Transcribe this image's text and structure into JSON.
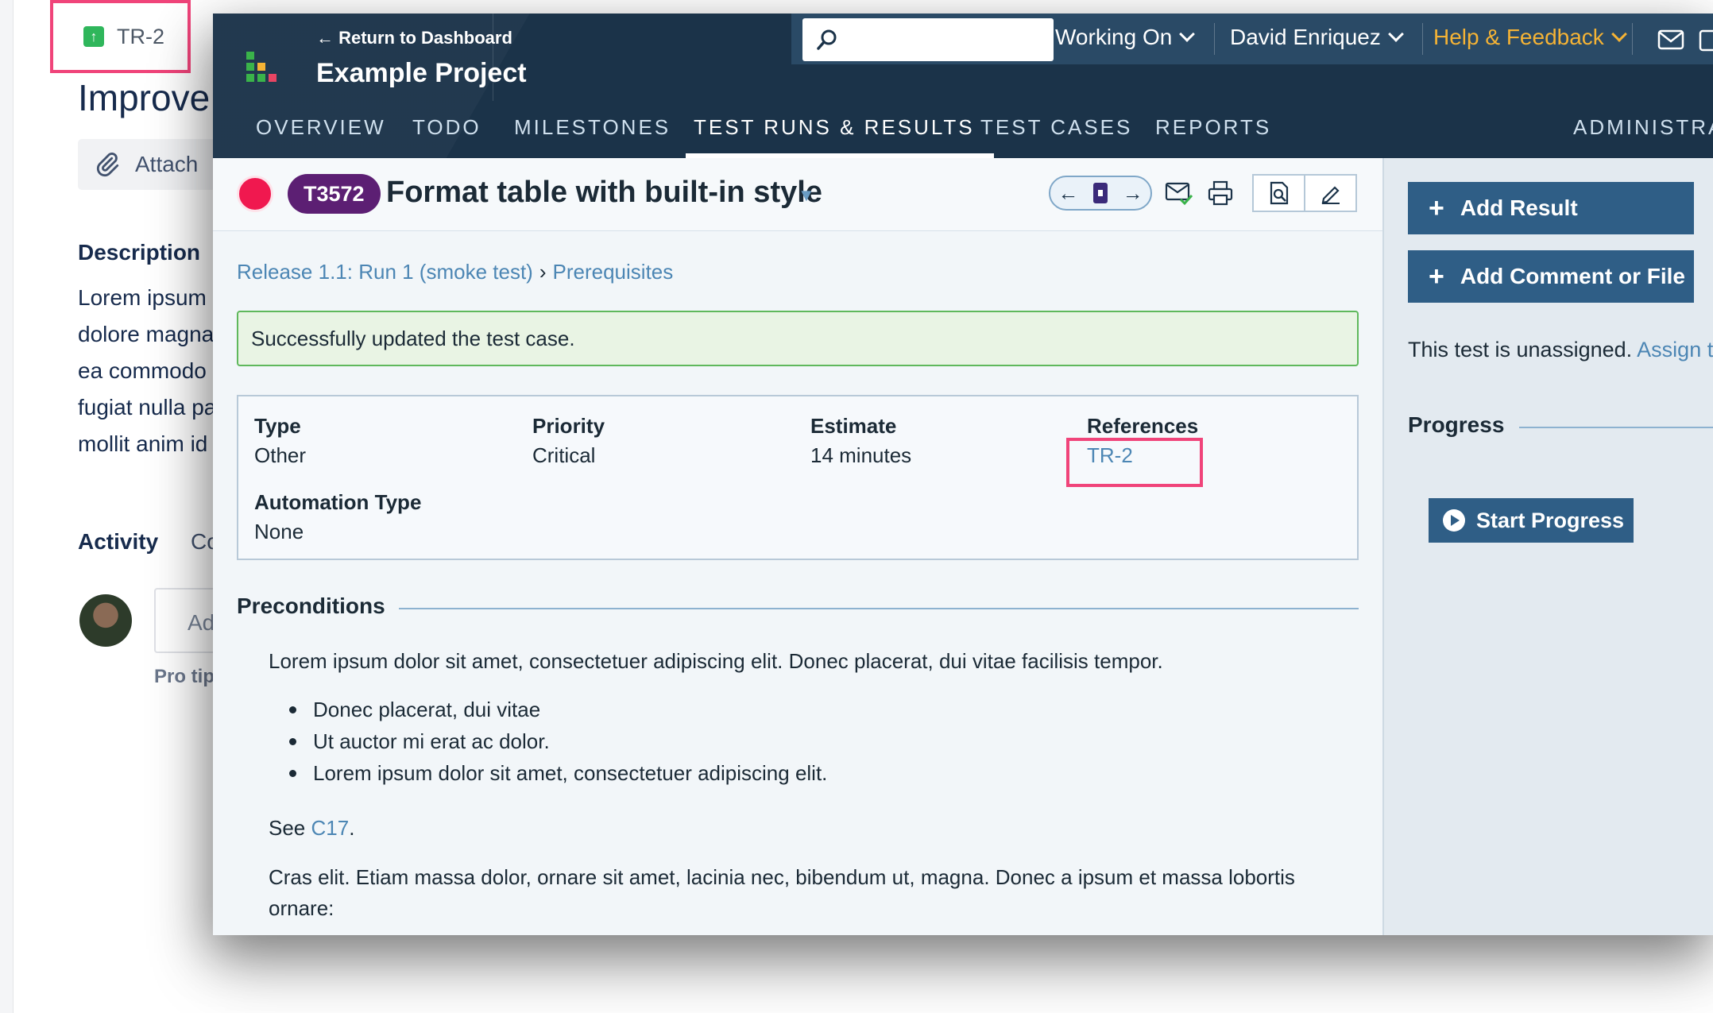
{
  "background_page": {
    "issue_key": "TR-2",
    "title": "Improve",
    "attach_label": "Attach",
    "description_heading": "Description",
    "description_lines": [
      "Lorem ipsum",
      "dolore magna",
      "ea commodo",
      "fugiat nulla pa",
      "mollit anim id"
    ],
    "activity_heading": "Activity",
    "activity_tab": "Co",
    "comment_placeholder": "Ad",
    "pro_tip": "Pro tip"
  },
  "header": {
    "return_label": "← Return to Dashboard",
    "project_name": "Example Project",
    "search_placeholder": "",
    "working_on": "Working On",
    "user_name": "David Enriquez",
    "help_label": "Help & Feedback",
    "help_color": "#f5b335"
  },
  "nav": {
    "tabs": [
      "OVERVIEW",
      "TODO",
      "MILESTONES",
      "TEST RUNS & RESULTS",
      "TEST CASES",
      "REPORTS"
    ],
    "active_tab": "TEST RUNS & RESULTS",
    "admin": "ADMINISTRAT"
  },
  "test": {
    "id": "T3572",
    "title": "Format table with built-in style",
    "status_color": "#f0184f",
    "breadcrumb": [
      "Release 1.1: Run 1 (smoke test)",
      "Prerequisites"
    ],
    "breadcrumb_sep": "›",
    "success_message": "Successfully updated the test case.",
    "properties": {
      "type_label": "Type",
      "type_value": "Other",
      "priority_label": "Priority",
      "priority_value": "Critical",
      "estimate_label": "Estimate",
      "estimate_value": "14 minutes",
      "references_label": "References",
      "references_value": "TR-2",
      "automation_label": "Automation Type",
      "automation_value": "None"
    },
    "preconditions": {
      "heading": "Preconditions",
      "intro": "Lorem ipsum dolor sit amet, consectetuer adipiscing elit. Donec placerat, dui vitae facilisis tempor.",
      "bullets": [
        "Donec placerat, dui vitae",
        "Ut auctor mi erat ac dolor.",
        "Lorem ipsum dolor sit amet, consectetuer adipiscing elit."
      ],
      "see_prefix": "See",
      "see_link": "C17",
      "see_suffix": ".",
      "closing": "Cras elit. Etiam massa dolor, ornare sit amet, lacinia nec, bibendum ut, magna. Donec a ipsum et massa lobortis ornare:"
    }
  },
  "sidebar": {
    "add_result": "Add Result",
    "add_comment": "Add Comment or File",
    "unassigned_text": "This test is unassigned.",
    "assign_link": "Assign t",
    "progress_heading": "Progress",
    "start_progress": "Start Progress"
  },
  "colors": {
    "header_bg": "#1b3349",
    "accent_blue": "#2f5e86",
    "link_blue": "#4c86b4",
    "highlight_pink": "#f0447a",
    "success_green": "#5fb85c"
  }
}
